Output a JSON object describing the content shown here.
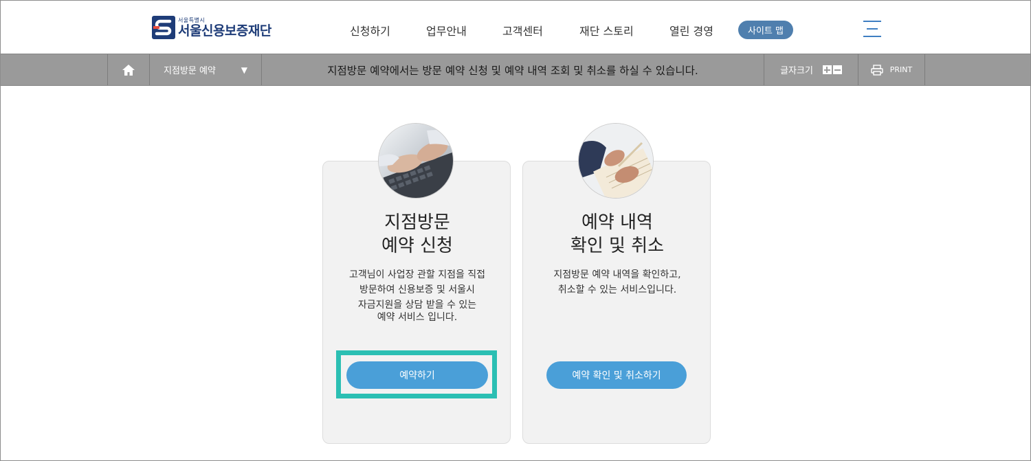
{
  "header": {
    "logo_sub": "서울특별시",
    "logo_main": "서울신용보증재단",
    "nav": [
      "신청하기",
      "업무안내",
      "고객센터",
      "재단 스토리",
      "열린 경영"
    ],
    "sitemap_label": "사이트 맵"
  },
  "bar": {
    "location": "지점방문 예약",
    "description": "지점방문 예약에서는 방문 예약 신청 및 예약 내역 조회 및 취소를 하실 수 있습니다.",
    "font_size_label": "글자크기",
    "print_label": "PRINT"
  },
  "cards": [
    {
      "title_line1": "지점방문",
      "title_line2": "예약 신청",
      "desc": [
        "고객님이 사업장 관할 지점을 직접",
        "방문하여 신용보증 및 서울시",
        "자금지원을 상담 받을 수 있는",
        "예약 서비스 입니다."
      ],
      "button": "예약하기"
    },
    {
      "title_line1": "예약 내역",
      "title_line2": "확인 및 취소",
      "desc": [
        "지점방문 예약 내역을 확인하고,",
        "취소할 수 있는 서비스입니다."
      ],
      "button": "예약 확인 및 취소하기"
    }
  ],
  "colors": {
    "brand": "#1e3c78",
    "button": "#4a9fd8",
    "highlight": "#2bbfb3",
    "bar": "#9a9a9a"
  }
}
